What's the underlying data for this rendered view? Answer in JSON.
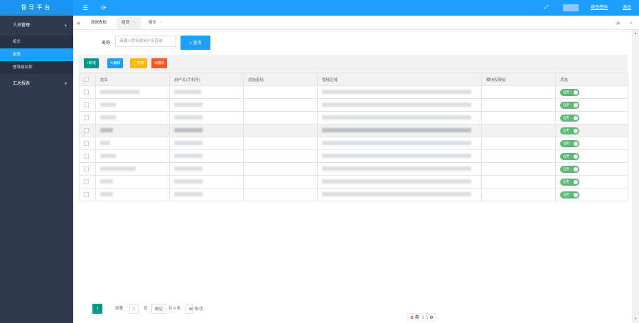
{
  "app": {
    "title": "督导平台",
    "menu_icon": "hamburger-icon",
    "refresh_icon": "refresh-icon",
    "fullscreen_icon": "fullscreen-icon",
    "change_password": "修改密码",
    "logout": "退出"
  },
  "sidebar": {
    "group1": "人员管理",
    "items": [
      "组长",
      "组员",
      "督导组名称"
    ],
    "group2": "汇总报表"
  },
  "tabs": {
    "items": [
      "数据看板",
      "组员",
      "组长"
    ],
    "close_glyph": "×"
  },
  "search": {
    "label": "名称",
    "placeholder": "请输入姓名或用户名查询",
    "button": "查询"
  },
  "toolbar": {
    "add": "+新增",
    "edit": "✎编辑",
    "disable": "◯禁用",
    "delete": "⊗删除"
  },
  "table": {
    "headers": [
      "姓名",
      "用户名(手机号)",
      "初始密码",
      "管辖区域",
      "模块权限组",
      "状态"
    ],
    "status_label": "启用",
    "highlight_row": 3,
    "rows": [
      {
        "name_w": 55,
        "user_w": 38,
        "area_w": 210
      },
      {
        "name_w": 22,
        "user_w": 40,
        "area_w": 210
      },
      {
        "name_w": 22,
        "user_w": 40,
        "area_w": 210
      },
      {
        "name_w": 18,
        "user_w": 40,
        "area_w": 210
      },
      {
        "name_w": 14,
        "user_w": 40,
        "area_w": 210
      },
      {
        "name_w": 22,
        "user_w": 40,
        "area_w": 210
      },
      {
        "name_w": 50,
        "user_w": 40,
        "area_w": 210
      },
      {
        "name_w": 18,
        "user_w": 40,
        "area_w": 210
      },
      {
        "name_w": 18,
        "user_w": 40,
        "area_w": 210
      }
    ]
  },
  "pager": {
    "current": "1",
    "goto": "到第",
    "page_input": "1",
    "page_unit": "页",
    "confirm": "确定",
    "total": "共 9 条",
    "per_page": "10 条/页"
  },
  "ime": {
    "text": "英"
  }
}
